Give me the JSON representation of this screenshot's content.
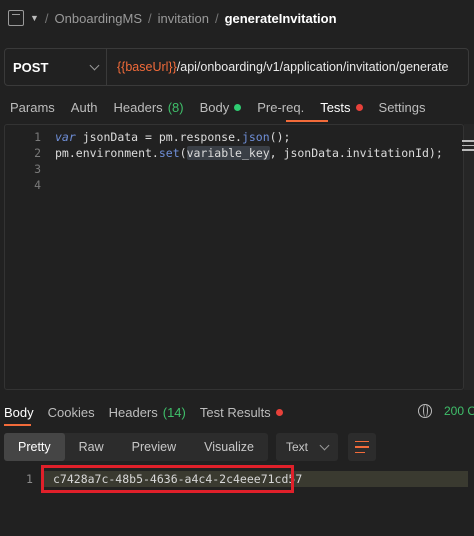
{
  "breadcrumb": {
    "items": [
      "OnboardingMS",
      "invitation"
    ],
    "current": "generateInvitation",
    "separator": "/"
  },
  "request": {
    "method": "POST",
    "url_variable": "{{baseUrl}}",
    "url_path": "/api/onboarding/v1/application/invitation/generate"
  },
  "request_tabs": [
    {
      "label": "Params"
    },
    {
      "label": "Auth"
    },
    {
      "label": "Headers",
      "count": "(8)"
    },
    {
      "label": "Body"
    },
    {
      "label": "Pre-req."
    },
    {
      "label": "Tests"
    },
    {
      "label": "Settings"
    }
  ],
  "active_request_tab": "Tests",
  "editor": {
    "line_numbers": [
      "1",
      "2",
      "3",
      "4"
    ],
    "line1": {
      "kw": "var",
      "a": " jsonData = pm.response.",
      "fn": "json",
      "b": "();"
    },
    "line2": {
      "a": "pm.environment.",
      "fn": "set",
      "b": "(",
      "hl": "variable_key",
      "c": ", jsonData.invitationId);"
    }
  },
  "response_tabs": [
    {
      "label": "Body"
    },
    {
      "label": "Cookies"
    },
    {
      "label": "Headers",
      "count": "(14)"
    },
    {
      "label": "Test Results"
    }
  ],
  "status_text": "200 O",
  "view_modes": [
    "Pretty",
    "Raw",
    "Preview",
    "Visualize"
  ],
  "active_view": "Pretty",
  "format_select": "Text",
  "response_body": {
    "line_number": "1",
    "value": "c7428a7c-48b5-4636-a4c4-2c4eee71cd57"
  },
  "colors": {
    "accent": "#f26b3a",
    "status_green": "#3fbf6a",
    "error_red": "#e8413a",
    "highlight_box": "#e0202a"
  }
}
